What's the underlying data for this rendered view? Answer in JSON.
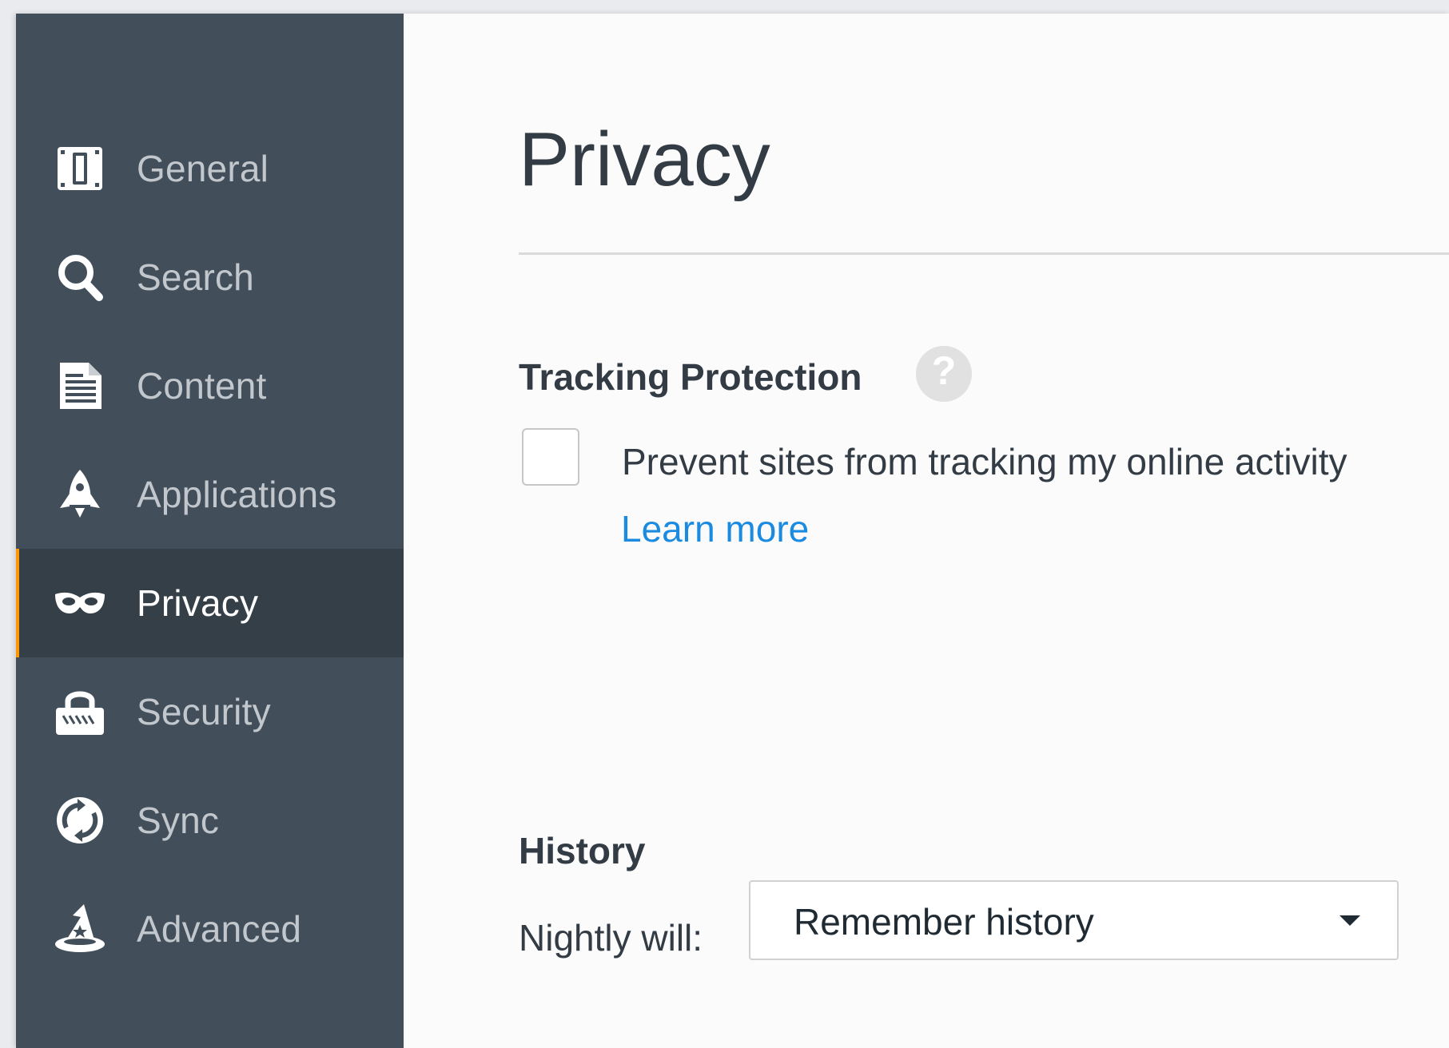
{
  "sidebar": {
    "items": [
      {
        "id": "general",
        "label": "General",
        "icon": "general-icon",
        "selected": false
      },
      {
        "id": "search",
        "label": "Search",
        "icon": "search-icon",
        "selected": false
      },
      {
        "id": "content",
        "label": "Content",
        "icon": "content-document-icon",
        "selected": false
      },
      {
        "id": "applications",
        "label": "Applications",
        "icon": "rocket-icon",
        "selected": false
      },
      {
        "id": "privacy",
        "label": "Privacy",
        "icon": "mask-icon",
        "selected": true
      },
      {
        "id": "security",
        "label": "Security",
        "icon": "lock-icon",
        "selected": false
      },
      {
        "id": "sync",
        "label": "Sync",
        "icon": "sync-icon",
        "selected": false
      },
      {
        "id": "advanced",
        "label": "Advanced",
        "icon": "wizard-hat-icon",
        "selected": false
      }
    ]
  },
  "main": {
    "title": "Privacy",
    "tracking": {
      "heading": "Tracking Protection",
      "help_glyph": "?",
      "checkbox_label": "Prevent sites from tracking my online activity",
      "checked": false,
      "learn_more": "Learn more"
    },
    "history": {
      "heading": "History",
      "label": "Nightly will:",
      "selected": "Remember history"
    }
  },
  "colors": {
    "sidebar_bg": "#424f5a",
    "sidebar_selected_bg": "#343f48",
    "selected_accent": "#ff9500",
    "link": "#1a8be1",
    "text": "#333c45"
  }
}
